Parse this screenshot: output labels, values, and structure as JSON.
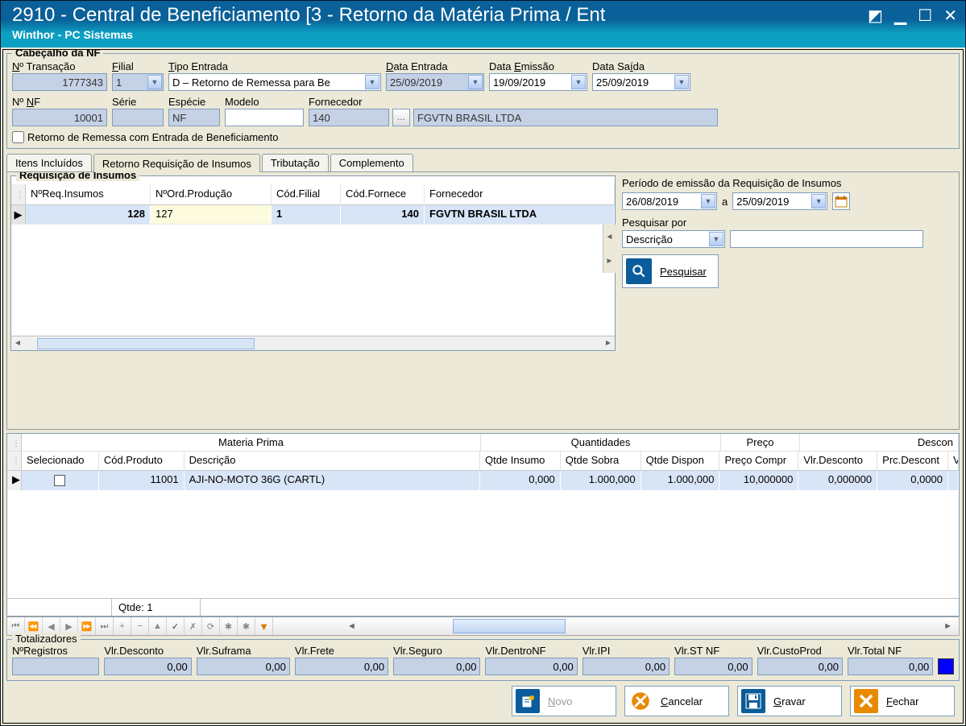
{
  "window": {
    "title": "2910 - Central de Beneficiamento [3 - Retorno da Matéria Prima / Ent",
    "subtitle": "Winthor - PC Sistemas"
  },
  "header": {
    "group_title": "Cabeçalho da NF",
    "labels": {
      "transacao": "Nº Transação",
      "filial": "Filial",
      "tipo_entrada": "Tipo Entrada",
      "data_entrada": "Data Entrada",
      "data_emissao": "Data Emissão",
      "data_saida": "Data Saída",
      "nf": "Nº NF",
      "serie": "Série",
      "especie": "Espécie",
      "modelo": "Modelo",
      "fornecedor": "Fornecedor"
    },
    "values": {
      "transacao": "1777343",
      "filial": "1",
      "tipo_entrada": "D – Retorno de Remessa para Be",
      "data_entrada": "25/09/2019",
      "data_emissao": "19/09/2019",
      "data_saida": "25/09/2019",
      "nf": "10001",
      "serie": "",
      "especie": "NF",
      "modelo": "",
      "fornecedor_cod": "140",
      "fornecedor_nome": "FGVTN BRASIL LTDA"
    },
    "checkbox": "Retorno de Remessa com Entrada de Beneficiamento"
  },
  "tabs": {
    "itens": "Itens Incluídos",
    "retorno": "Retorno Requisição de Insumos",
    "tributacao": "Tributação",
    "complemento": "Complemento"
  },
  "requisicao": {
    "title": "Requisição de Insumos",
    "cols": {
      "req": "NºReq.Insumos",
      "ord": "NºOrd.Produção",
      "filial": "Cód.Filial",
      "fornec_cod": "Cód.Fornece",
      "fornec": "Fornecedor"
    },
    "row": {
      "req": "128",
      "ord": "127",
      "filial": "1",
      "fornec_cod": "140",
      "fornec": "FGVTN BRASIL LTDA"
    }
  },
  "filter": {
    "periodo_label": "Período de emissão da Requisição de Insumos",
    "date_from": "26/08/2019",
    "a": "a",
    "date_to": "25/09/2019",
    "pesquisar_por": "Pesquisar por",
    "descricao": "Descrição",
    "pesquisar": "Pesquisar"
  },
  "materia": {
    "super": {
      "mp": "Materia Prima",
      "qtd": "Quantidades",
      "preco": "Preço",
      "desc": "Descon"
    },
    "cols": {
      "sel": "Selecionado",
      "cod": "Cód.Produto",
      "desc": "Descrição",
      "qi": "Qtde Insumo",
      "qs": "Qtde Sobra",
      "qd": "Qtde Dispon",
      "pc": "Preço Compr",
      "vd": "Vlr.Desconto",
      "pd": "Prc.Descont",
      "v": "V"
    },
    "row": {
      "cod": "11001",
      "desc": "AJI-NO-MOTO 36G (CARTL)",
      "qi": "0,000",
      "qs": "1.000,000",
      "qd": "1.000,000",
      "pc": "10,000000",
      "vd": "0,000000",
      "pd": "0,0000"
    },
    "qtde_label": "Qtde: 1"
  },
  "totals": {
    "title": "Totalizadores",
    "labels": {
      "reg": "NºRegistros",
      "desc": "Vlr.Desconto",
      "suframa": "Vlr.Suframa",
      "frete": "Vlr.Frete",
      "seguro": "Vlr.Seguro",
      "dentro": "Vlr.DentroNF",
      "ipi": "Vlr.IPI",
      "st": "Vlr.ST NF",
      "custo": "Vlr.CustoProd",
      "total": "Vlr.Total NF"
    },
    "values": {
      "reg": "",
      "desc": "0,00",
      "suframa": "0,00",
      "frete": "0,00",
      "seguro": "0,00",
      "dentro": "0,00",
      "ipi": "0,00",
      "st": "0,00",
      "custo": "0,00",
      "total": "0,00"
    }
  },
  "buttons": {
    "novo": "Novo",
    "cancelar": "Cancelar",
    "gravar": "Gravar",
    "fechar": "Fechar"
  }
}
